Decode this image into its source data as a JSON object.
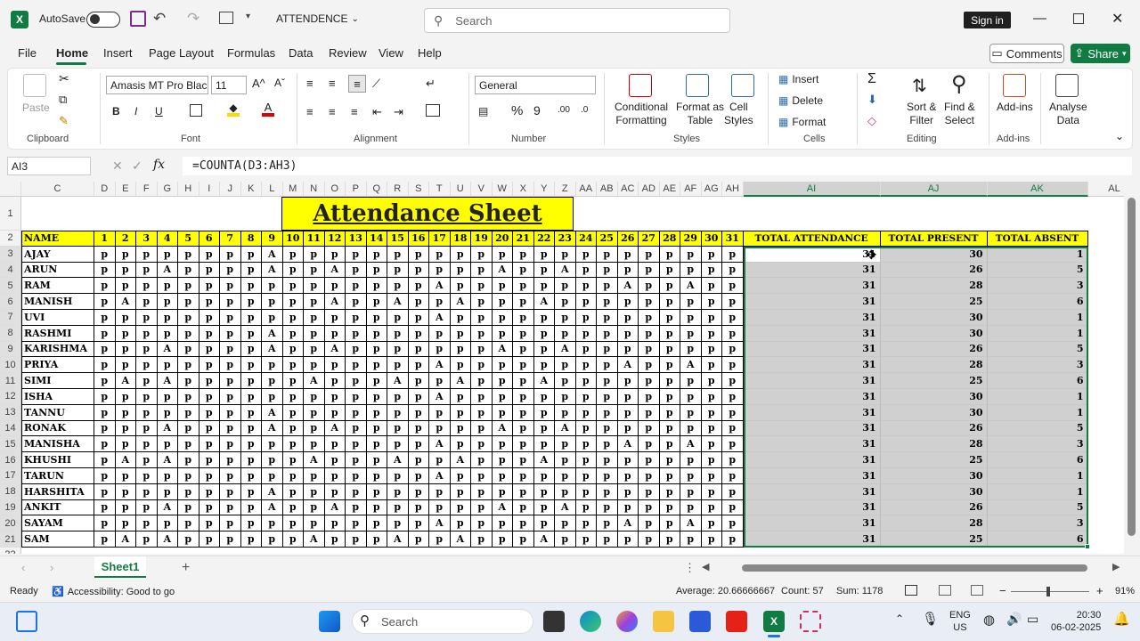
{
  "titlebar": {
    "autosave": "AutoSave",
    "file_name": "ATTENDENCE",
    "search_placeholder": "Search",
    "sign_in": "Sign in"
  },
  "menu": [
    "File",
    "Home",
    "Insert",
    "Page Layout",
    "Formulas",
    "Data",
    "Review",
    "View",
    "Help"
  ],
  "comments": "Comments",
  "share": "Share",
  "ribbon": {
    "clipboard": {
      "label": "Clipboard",
      "paste": "Paste"
    },
    "font": {
      "label": "Font",
      "font_name": "Amasis MT Pro Blac",
      "font_size": "11",
      "bold": "B",
      "italic": "I",
      "underline": "U"
    },
    "alignment": {
      "label": "Alignment"
    },
    "number": {
      "label": "Number",
      "format": "General"
    },
    "styles": {
      "label": "Styles",
      "conditional": "Conditional",
      "conditional2": "Formatting",
      "format_as": "Format as",
      "format_as2": "Table",
      "cell": "Cell",
      "cell2": "Styles"
    },
    "cells": {
      "label": "Cells",
      "insert": "Insert",
      "delete": "Delete",
      "format": "Format"
    },
    "editing": {
      "label": "Editing",
      "sort": "Sort &",
      "sort2": "Filter",
      "find": "Find &",
      "find2": "Select"
    },
    "addins": {
      "label": "Add-ins",
      "addins": "Add-ins"
    },
    "analyse": {
      "a1": "Analyse",
      "a2": "Data"
    }
  },
  "formula_bar": {
    "name_box": "AI3",
    "formula": "=COUNTA(D3:AH3)"
  },
  "columns_left": [
    "C",
    "D",
    "E",
    "F",
    "G",
    "H",
    "I",
    "J",
    "K",
    "L",
    "M",
    "N",
    "O",
    "P",
    "Q",
    "R",
    "S",
    "T",
    "U",
    "V",
    "W",
    "X",
    "Y",
    "Z",
    "AA",
    "AB",
    "AC",
    "AD",
    "AE",
    "AF",
    "AG",
    "AH"
  ],
  "columns_right": [
    "AI",
    "AJ",
    "AK",
    "AL"
  ],
  "sheet": {
    "title": "Attendance Sheet",
    "header_name": "NAME",
    "days": [
      "1",
      "2",
      "3",
      "4",
      "5",
      "6",
      "7",
      "8",
      "9",
      "10",
      "11",
      "12",
      "13",
      "14",
      "15",
      "16",
      "17",
      "18",
      "19",
      "20",
      "21",
      "22",
      "23",
      "24",
      "25",
      "26",
      "27",
      "28",
      "29",
      "30",
      "31"
    ],
    "header_total": "TOTAL ATTENDANCE",
    "header_present": "TOTAL PRESENT",
    "header_absent": "TOTAL ABSENT",
    "rows": [
      {
        "name": "AJAY",
        "marks": "ppppppppAppppppppppppppppppppppp",
        "total": "31",
        "present": "30",
        "absent": "1"
      },
      {
        "name": "ARUN",
        "marks": "pppAppppAppApppppppAppApppppppppA",
        "total": "31",
        "present": "26",
        "absent": "5"
      },
      {
        "name": "RAM",
        "marks": "ppppppppppppppppAppppppppAppAppp",
        "total": "31",
        "present": "28",
        "absent": "3"
      },
      {
        "name": "MANISH",
        "marks": "pApppppppppAppAppApppApppppppppp",
        "total": "31",
        "present": "25",
        "absent": "6"
      },
      {
        "name": "UVI",
        "marks": "ppppppppppppppppApppppppppppppppp",
        "total": "31",
        "present": "30",
        "absent": "1"
      },
      {
        "name": "RASHMI",
        "marks": "ppppppppAppppppppppppppppppppppp",
        "total": "31",
        "present": "30",
        "absent": "1"
      },
      {
        "name": "KARISHMA",
        "marks": "pppAppppAppApppppppAppApppppppppA",
        "total": "31",
        "present": "26",
        "absent": "5"
      },
      {
        "name": "PRIYA",
        "marks": "ppppppppppppppppAppppppppAppAppp",
        "total": "31",
        "present": "28",
        "absent": "3"
      },
      {
        "name": "SIMI",
        "marks": "pApAppppppApppAppApppAppppppppppp",
        "total": "31",
        "present": "25",
        "absent": "6"
      },
      {
        "name": "ISHA",
        "marks": "ppppppppppppppppApppppppppppppppp",
        "total": "31",
        "present": "30",
        "absent": "1"
      },
      {
        "name": "TANNU",
        "marks": "ppppppppAppppppppppppppppppppppp",
        "total": "31",
        "present": "30",
        "absent": "1"
      },
      {
        "name": "RONAK",
        "marks": "pppAppppAppApppppppAppApppppppppA",
        "total": "31",
        "present": "26",
        "absent": "5"
      },
      {
        "name": "MANISHA",
        "marks": "ppppppppppppppppAppppppppAppAppp",
        "total": "31",
        "present": "28",
        "absent": "3"
      },
      {
        "name": "KHUSHI",
        "marks": "pApAppppppApppAppApppAppppppppppp",
        "total": "31",
        "present": "25",
        "absent": "6"
      },
      {
        "name": "TARUN",
        "marks": "ppppppppppppppppApppppppppppppppp",
        "total": "31",
        "present": "30",
        "absent": "1"
      },
      {
        "name": "HARSHITA",
        "marks": "ppppppppAppppppppppppppppppppppp",
        "total": "31",
        "present": "30",
        "absent": "1"
      },
      {
        "name": "ANKIT",
        "marks": "pppAppppAppApppppppAppApppppppppA",
        "total": "31",
        "present": "26",
        "absent": "5"
      },
      {
        "name": "SAYAM",
        "marks": "ppppppppppppppppAppppppppAppAppp",
        "total": "31",
        "present": "28",
        "absent": "3"
      },
      {
        "name": "SAM",
        "marks": "pApAppppppApppAppApppAppppppppppp",
        "total": "31",
        "present": "25",
        "absent": "6"
      }
    ]
  },
  "sheet_tab": "Sheet1",
  "status": {
    "ready": "Ready",
    "accessibility": "Accessibility: Good to go",
    "average": "Average: 20.66666667",
    "count": "Count: 57",
    "sum": "Sum: 1178",
    "zoom": "91%"
  },
  "taskbar": {
    "search": "Search",
    "lang1": "ENG",
    "lang2": "US",
    "time": "20:30",
    "date": "06-02-2025"
  }
}
